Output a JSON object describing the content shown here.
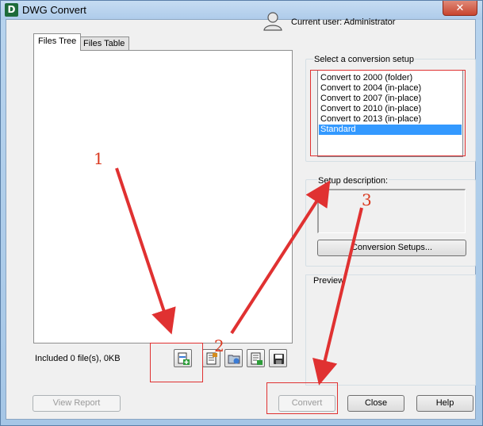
{
  "window": {
    "app_icon_letter": "D",
    "title": "DWG Convert",
    "close_glyph": "✕"
  },
  "header": {
    "current_user": "Current user: Administrator"
  },
  "tabs": [
    {
      "label": "Files Tree",
      "active": true
    },
    {
      "label": "Files Table",
      "active": false
    }
  ],
  "files": {
    "status": "Included 0 file(s), 0KB",
    "toolbar_icons": [
      "add-file-icon",
      "add-files-from-list-icon",
      "add-folder-icon",
      "import-list-icon",
      "save-list-icon"
    ]
  },
  "setups": {
    "label": "Select a conversion setup",
    "items": [
      "Convert to 2000 (folder)",
      "Convert to 2004 (in-place)",
      "Convert to 2007 (in-place)",
      "Convert to 2010 (in-place)",
      "Convert to 2013 (in-place)",
      "Standard"
    ],
    "selected_index": 5,
    "description_label": "Setup description:",
    "setups_button": "Conversion Setups..."
  },
  "preview": {
    "label": "Preview"
  },
  "footer": {
    "view_report": "View Report",
    "convert": "Convert",
    "close": "Close",
    "help": "Help"
  },
  "annotations": {
    "step_1": "1",
    "step_2": "2",
    "step_3": "3",
    "color": "#e03131"
  }
}
